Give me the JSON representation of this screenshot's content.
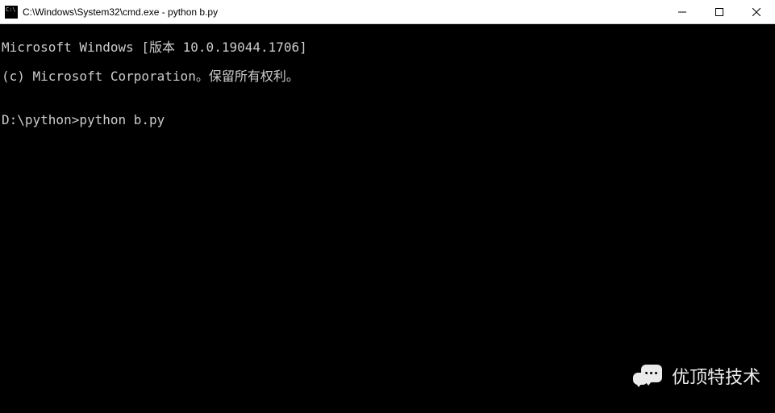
{
  "titlebar": {
    "title": "C:\\Windows\\System32\\cmd.exe - python  b.py"
  },
  "terminal": {
    "line1": "Microsoft Windows [版本 10.0.19044.1706]",
    "line2": "(c) Microsoft Corporation。保留所有权利。",
    "blank": "",
    "prompt": "D:\\python>",
    "command": "python b.py"
  },
  "watermark": {
    "text": "优顶特技术"
  }
}
